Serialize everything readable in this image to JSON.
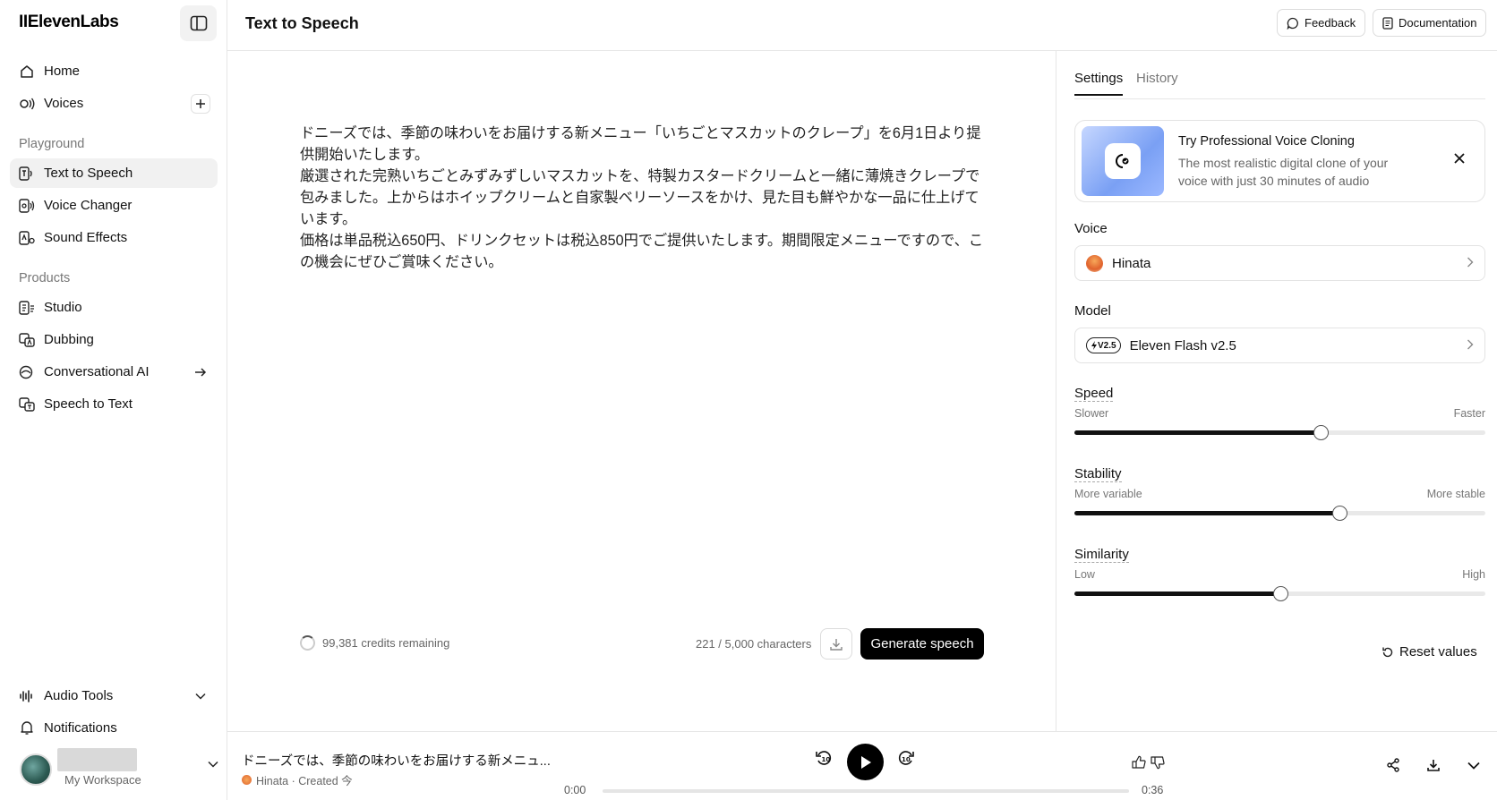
{
  "app": {
    "logo": "IIElevenLabs"
  },
  "sidebar": {
    "items": [
      {
        "label": "Home",
        "icon": "home-icon"
      },
      {
        "label": "Voices",
        "icon": "voices-icon"
      },
      {
        "label": "Text to Speech",
        "icon": "tts-icon"
      },
      {
        "label": "Voice Changer",
        "icon": "voice-changer-icon"
      },
      {
        "label": "Sound Effects",
        "icon": "sound-effects-icon"
      },
      {
        "label": "Studio",
        "icon": "studio-icon"
      },
      {
        "label": "Dubbing",
        "icon": "dubbing-icon"
      },
      {
        "label": "Conversational AI",
        "icon": "conversational-ai-icon"
      },
      {
        "label": "Speech to Text",
        "icon": "speech-to-text-icon"
      }
    ],
    "sections": {
      "playground": "Playground",
      "products": "Products"
    },
    "bottom": {
      "audio_tools": "Audio Tools",
      "notifications": "Notifications",
      "workspace": "My Workspace"
    }
  },
  "header": {
    "title": "Text to Speech",
    "feedback": "Feedback",
    "documentation": "Documentation"
  },
  "editor": {
    "text": "ドニーズでは、季節の味わいをお届けする新メニュー「いちごとマスカットのクレープ」を6月1日より提供開始いたします。\n厳選された完熟いちごとみずみずしいマスカットを、特製カスタードクリームと一緒に薄焼きクレープで包みました。上からはホイップクリームと自家製ベリーソースをかけ、見た目も鮮やかな一品に仕上げています。\n価格は単品税込650円、ドリンクセットは税込850円でご提供いたします。期間限定メニューですので、この機会にぜひご賞味ください。",
    "credits": "99,381 credits remaining",
    "char_count": "221 / 5,000 characters",
    "generate": "Generate speech"
  },
  "panel": {
    "tabs": {
      "settings": "Settings",
      "history": "History"
    },
    "promo": {
      "title": "Try Professional Voice Cloning",
      "subtitle": "The most realistic digital clone of your voice with just 30 minutes of audio"
    },
    "voice_label": "Voice",
    "voice_value": "Hinata",
    "model_label": "Model",
    "model_badge": "V2.5",
    "model_value": "Eleven Flash v2.5",
    "speed": {
      "title": "Speed",
      "low": "Slower",
      "high": "Faster",
      "value": 0.6
    },
    "stability": {
      "title": "Stability",
      "low": "More variable",
      "high": "More stable",
      "value": 0.645
    },
    "similarity": {
      "title": "Similarity",
      "low": "Low",
      "high": "High",
      "value": 0.5
    },
    "reset": "Reset values"
  },
  "player": {
    "title": "ドニーズでは、季節の味わいをお届けする新メニュ...",
    "meta": "Hinata · Created 今",
    "time_start": "0:00",
    "time_end": "0:36",
    "progress": 0
  }
}
